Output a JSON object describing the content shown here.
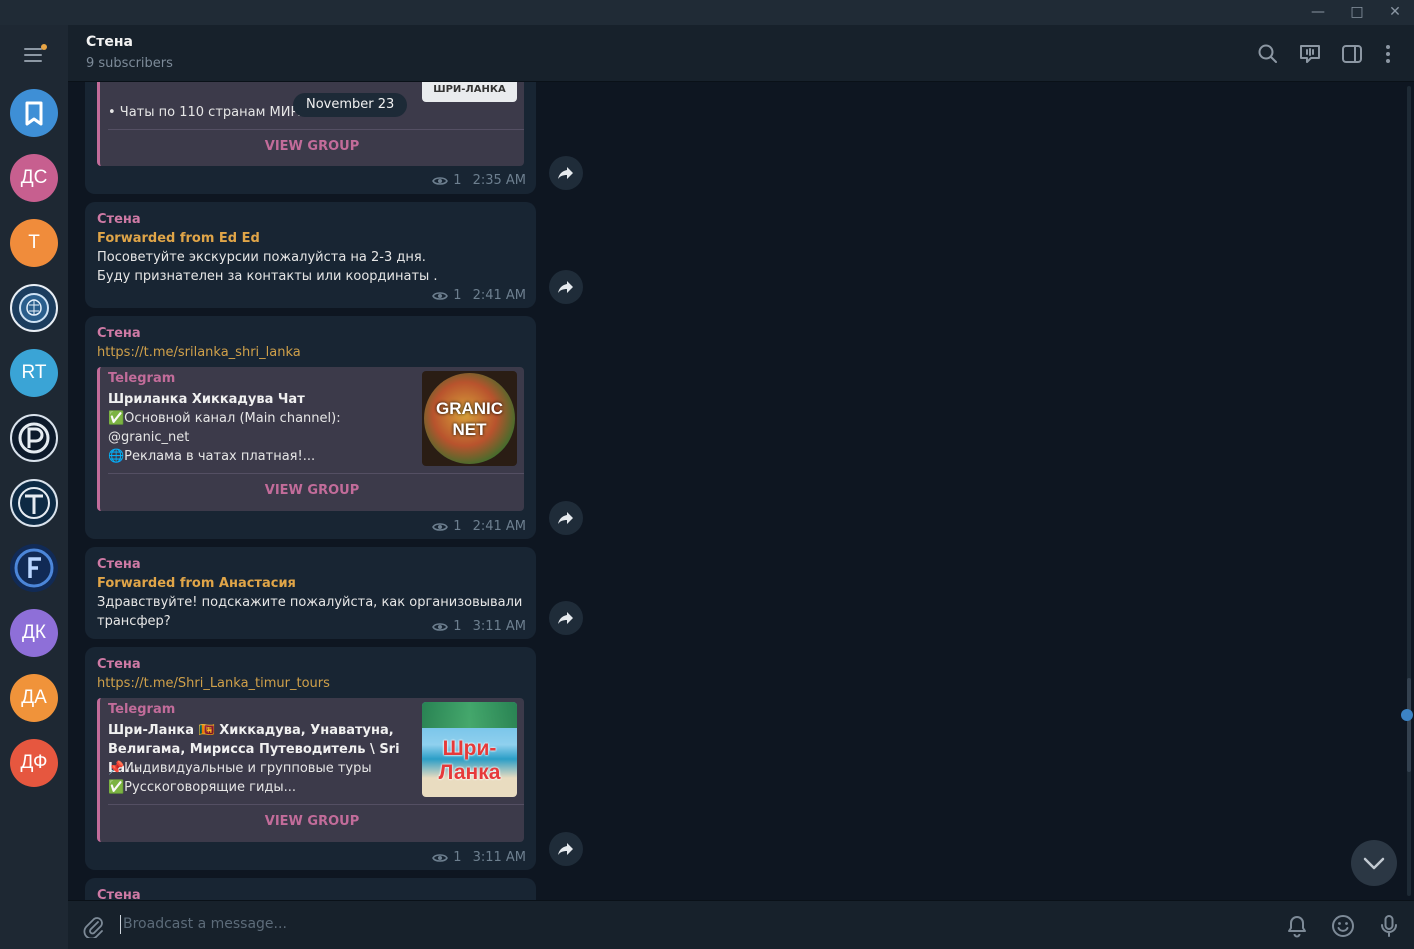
{
  "window": {
    "minimize": "—",
    "maximize": "□",
    "close": "✕"
  },
  "sidebar": {
    "menu_icon": "hamburger-menu-icon",
    "chats": [
      {
        "label": "",
        "icon": "bookmark-icon",
        "color": "#3e8fd6"
      },
      {
        "label": "ДС",
        "color": "#c75f8f"
      },
      {
        "label": "Т",
        "color": "#f08c3b"
      },
      {
        "label": "",
        "icon": "brain-logo-icon",
        "color": "#1c3d5e"
      },
      {
        "label": "RT",
        "color": "#3aa4d6"
      },
      {
        "label": "",
        "icon": "p-logo-icon",
        "color": "#0d1a2b"
      },
      {
        "label": "",
        "icon": "t-logo-icon",
        "color": "#0d2a44"
      },
      {
        "label": "",
        "icon": "f-logo-icon",
        "color": "#112a55"
      },
      {
        "label": "ДК",
        "color": "#8e6fd8"
      },
      {
        "label": "ДА",
        "color": "#f0933a"
      },
      {
        "label": "ДФ",
        "color": "#e6573f"
      }
    ]
  },
  "header": {
    "title": "Стена",
    "subtitle": "9 subscribers",
    "icons": [
      "search-icon",
      "live-stream-icon",
      "sidebar-toggle-icon",
      "more-vertical-icon"
    ]
  },
  "date_pill": "November 23",
  "messages": [
    {
      "partial_card": {
        "text": "• Чаты по 110 странам МИРА...",
        "thumb_text": "ШРИ-ЛАНКА",
        "button": "VIEW GROUP"
      },
      "views": "1",
      "time": "2:35 AM"
    },
    {
      "sender": "Стена",
      "forwarded": "Forwarded from Ed Ed",
      "text": [
        "Посоветуйте экскурсии пожалуйста на 2-3 дня.",
        "Буду признателен за контакты или координаты ."
      ],
      "views": "1",
      "time": "2:41 AM"
    },
    {
      "sender": "Стена",
      "link": "https://t.me/srilanka_shri_lanka",
      "card": {
        "site": "Telegram",
        "title": "Шриланка Хиккадува Чат",
        "desc": [
          "✅Основной канал (Main channel):",
          "@granic_net",
          "🌐Реклама в чатах платная!..."
        ],
        "thumb_text": [
          "GRANIC",
          "NET"
        ],
        "button": "VIEW GROUP"
      },
      "views": "1",
      "time": "2:41 AM"
    },
    {
      "sender": "Стена",
      "forwarded": "Forwarded from Анастасия",
      "text": [
        "Здравствуйте! подскажите пожалуйста, как организовывали",
        "трансфер?"
      ],
      "views": "1",
      "time": "3:11 AM"
    },
    {
      "sender": "Стена",
      "link": "https://t.me/Shri_Lanka_timur_tours",
      "card": {
        "site": "Telegram",
        "title": [
          "Шри-Ланка 🇱🇰 Хиккадува, Унаватуна,",
          "Велигама, Мирисса Путеводитель \\ Sri La..."
        ],
        "desc": [
          "📌Индивидуальные и групповые туры",
          "✅Русскоговорящие гиды..."
        ],
        "thumb_text": "Шри-Ланка",
        "button": "VIEW GROUP"
      },
      "views": "1",
      "time": "3:11 AM"
    },
    {
      "sender": "Стена"
    }
  ],
  "input": {
    "placeholder": "Broadcast a message...",
    "icons": [
      "attach-icon",
      "bell-icon",
      "emoji-icon",
      "microphone-icon"
    ]
  },
  "colors": {
    "background": "#0e1621",
    "bubble": "#182533",
    "sender": "#cf7aa5",
    "forwarded": "#e0a548",
    "card": "#3c3a4a",
    "card_accent": "#c26c9a"
  }
}
